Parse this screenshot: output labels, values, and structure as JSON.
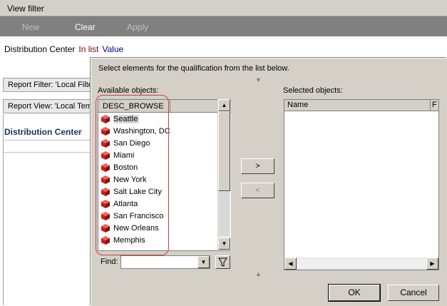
{
  "view_filter": {
    "title": "View filter",
    "toolbar": {
      "new_label": "New",
      "clear_label": "Clear",
      "apply_label": "Apply"
    },
    "condition": {
      "attribute": "Distribution Center",
      "operator": "In list",
      "value": "Value"
    }
  },
  "background": {
    "report_filter_tab": "Report Filter: 'Local Filter'",
    "report_view_tab": "Report View: 'Local Template'",
    "grid_header": "Distribution Center"
  },
  "dialog": {
    "instruction": "Select elements for the qualification from the list below.",
    "available_label": "Available objects:",
    "available_column": "DESC_BROWSE",
    "available_items": [
      "Seattle",
      "Washington, DC",
      "San Diego",
      "Miami",
      "Boston",
      "New York",
      "Salt Lake City",
      "Atlanta",
      "San Francisco",
      "New Orleans",
      "Memphis"
    ],
    "add_label": ">",
    "remove_label": "<",
    "selected_label": "Selected objects:",
    "selected_columns": [
      "Name",
      "F"
    ],
    "find_label": "Find:",
    "find_value": "",
    "ok_label": "OK",
    "cancel_label": "Cancel"
  },
  "colors": {
    "item_icon": "#c81e1e",
    "highlight_border": "#d04040",
    "toolbar_bg": "#808080"
  }
}
